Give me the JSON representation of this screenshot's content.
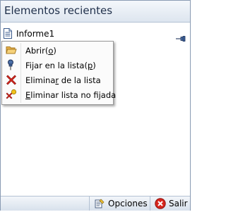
{
  "panel": {
    "title": "Elementos recientes"
  },
  "recent_items": [
    {
      "label": "Informe1",
      "icon": "document-icon",
      "pinned": false
    }
  ],
  "context_menu": {
    "items": [
      {
        "pre": "Abrir(",
        "accel": "o",
        "post": ")",
        "icon": "open-folder-icon"
      },
      {
        "pre": "Fijar en la lista(",
        "accel": "p",
        "post": ")",
        "icon": "pushpin-icon"
      },
      {
        "pre": "Elimina",
        "accel": "r",
        "post": " de la lista",
        "icon": "red-x-icon"
      },
      {
        "pre": "",
        "accel": "E",
        "post": "liminar lista no fijada",
        "icon": "remove-unpinned-icon"
      }
    ]
  },
  "footer": {
    "options_label": "Opciones",
    "exit_label": "Salir"
  },
  "colors": {
    "header_text": "#1f2f4a",
    "border": "#8a9bb3",
    "exit_red": "#d7261e"
  }
}
